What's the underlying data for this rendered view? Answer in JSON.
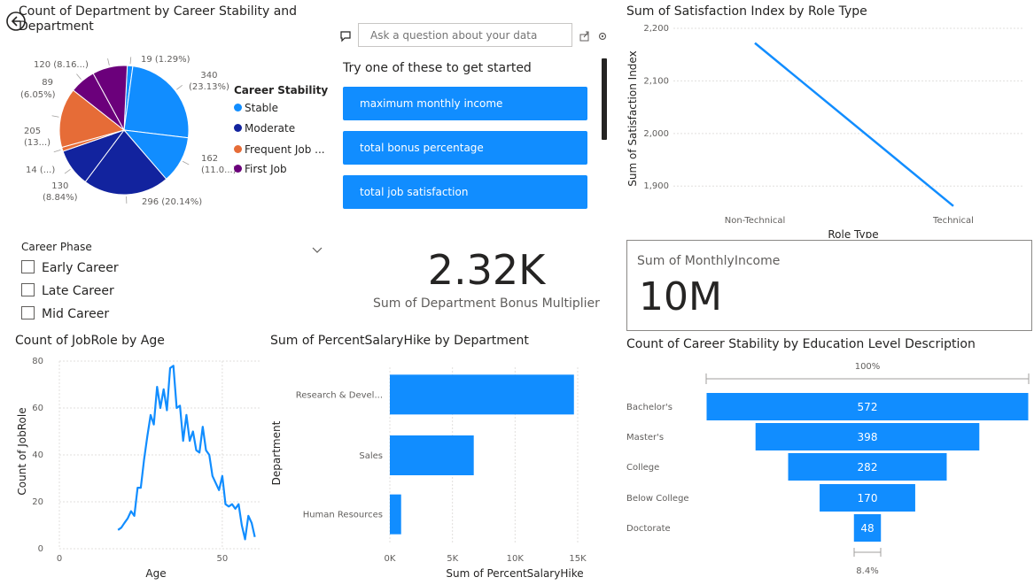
{
  "colors": {
    "accent": "#118dff",
    "stable": "#118dff",
    "moderate": "#12239e",
    "frequent": "#e66c37",
    "first_job": "#6b007b"
  },
  "pie": {
    "title_line1": "Count of Department by Career Stability and",
    "title_line2": "Department",
    "legend_title": "Career Stability",
    "legend": [
      "Stable",
      "Moderate",
      "Frequent Job ...",
      "First Job"
    ],
    "labels": {
      "l19": "19 (1.29%)",
      "l340a": "340",
      "l340b": "(23.13%)",
      "l162a": "162",
      "l162b": "(11.0...)",
      "l296": "296 (20.14%)",
      "l130a": "130",
      "l130b": "(8.84%)",
      "l14": "14 (...)",
      "l205a": "205",
      "l205b": "(13...)",
      "l89a": "89",
      "l89b": "(6.05%)",
      "l120": "120 (8.16...)"
    }
  },
  "qa": {
    "placeholder": "Ask a question about your data",
    "heading": "Try one of these to get started",
    "suggestions": [
      "maximum monthly income",
      "total bonus percentage",
      "total job satisfaction"
    ]
  },
  "slicer": {
    "title": "Career Phase",
    "options": [
      "Early Career",
      "Late Career",
      "Mid Career"
    ]
  },
  "kpi_bonus": {
    "value": "2.32K",
    "label": "Sum of Department Bonus Multiplier"
  },
  "kpi_income": {
    "label": "Sum of MonthlyIncome",
    "value": "10M"
  },
  "sat_chart": {
    "title": "Sum of Satisfaction Index by Role Type",
    "ylabel": "Sum of Satisfaction Index",
    "xlabel": "Role Type",
    "yticks": [
      "2,200",
      "2,100",
      "2,000",
      "1,900"
    ],
    "xticks": [
      "Non-Technical",
      "Technical"
    ]
  },
  "age_chart": {
    "title": "Count of JobRole by Age",
    "ylabel": "Count of JobRole",
    "xlabel": "Age",
    "yticks": [
      "80",
      "60",
      "40",
      "20",
      "0"
    ],
    "xticks": [
      "0",
      "50"
    ]
  },
  "hike_chart": {
    "title": "Sum of PercentSalaryHike by Department",
    "ylabel": "Department",
    "xlabel": "Sum of PercentSalaryHike",
    "categories": [
      "Research & Devel...",
      "Sales",
      "Human Resources"
    ],
    "xticks": [
      "0K",
      "5K",
      "10K",
      "15K"
    ]
  },
  "funnel": {
    "title": "Count of Career Stability by Education Level Description",
    "top_pct": "100%",
    "bottom_pct": "8.4%",
    "categories": [
      "Bachelor's",
      "Master's",
      "College",
      "Below College",
      "Doctorate"
    ],
    "value_labels": [
      "572",
      "398",
      "282",
      "170",
      "48"
    ]
  },
  "chart_data": [
    {
      "type": "pie",
      "title": "Count of Department by Career Stability and Department",
      "legend_title": "Career Stability",
      "slices": [
        {
          "stability": "Stable",
          "value": 19
        },
        {
          "stability": "Stable",
          "value": 340
        },
        {
          "stability": "Stable",
          "value": 162
        },
        {
          "stability": "Moderate",
          "value": 296
        },
        {
          "stability": "Moderate",
          "value": 130
        },
        {
          "stability": "Frequent Job ...",
          "value": 14
        },
        {
          "stability": "Frequent Job ...",
          "value": 205
        },
        {
          "stability": "First Job",
          "value": 89
        },
        {
          "stability": "First Job",
          "value": 120
        }
      ]
    },
    {
      "type": "line",
      "title": "Sum of Satisfaction Index by Role Type",
      "categories": [
        "Non-Technical",
        "Technical"
      ],
      "values": [
        2172,
        1862
      ],
      "ylim": [
        1860,
        2200
      ]
    },
    {
      "type": "line",
      "title": "Count of JobRole by Age",
      "xlim": [
        0,
        62
      ],
      "ylim": [
        0,
        80
      ],
      "x": [
        18,
        19,
        20,
        21,
        22,
        23,
        24,
        25,
        26,
        27,
        28,
        29,
        30,
        31,
        32,
        33,
        34,
        35,
        36,
        37,
        38,
        39,
        40,
        41,
        42,
        43,
        44,
        45,
        46,
        47,
        48,
        49,
        50,
        51,
        52,
        53,
        54,
        55,
        56,
        57,
        58,
        59,
        60
      ],
      "y": [
        8,
        9,
        11,
        13,
        16,
        14,
        26,
        26,
        38,
        48,
        57,
        53,
        69,
        60,
        68,
        59,
        77,
        78,
        60,
        61,
        46,
        57,
        46,
        50,
        42,
        41,
        52,
        42,
        40,
        31,
        28,
        25,
        31,
        19,
        18,
        19,
        17,
        19,
        10,
        4,
        14,
        11,
        5
      ]
    },
    {
      "type": "bar",
      "title": "Sum of PercentSalaryHike by Department",
      "categories": [
        "Research & Devel...",
        "Sales",
        "Human Resources"
      ],
      "values": [
        14700,
        6700,
        900
      ],
      "xlim": [
        0,
        15000
      ]
    },
    {
      "type": "bar",
      "title": "Count of Career Stability by Education Level Description",
      "categories": [
        "Bachelor's",
        "Master's",
        "College",
        "Below College",
        "Doctorate"
      ],
      "values": [
        572,
        398,
        282,
        170,
        48
      ]
    }
  ]
}
